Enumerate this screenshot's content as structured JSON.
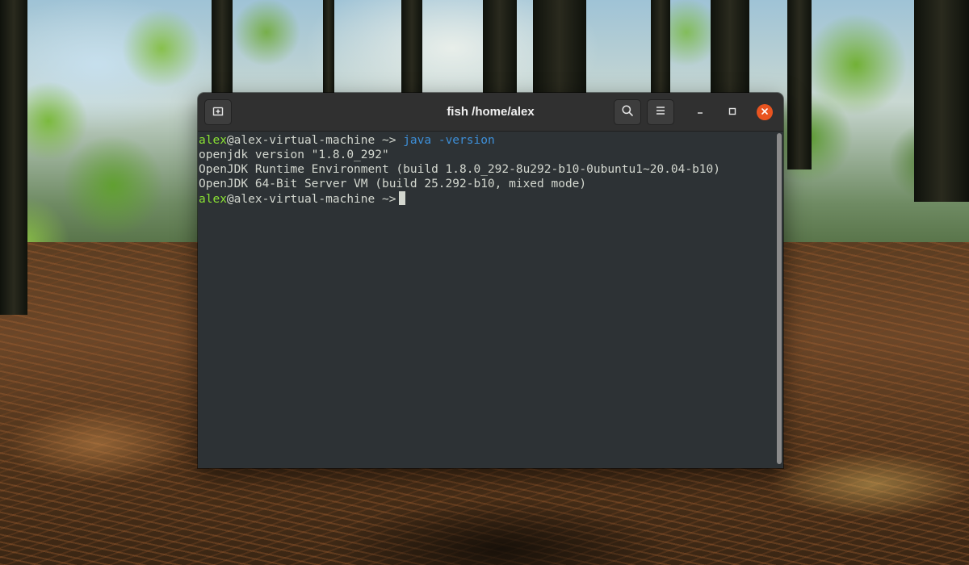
{
  "window": {
    "title": "fish /home/alex",
    "icons": {
      "new_tab": "new-tab-icon",
      "search": "search-icon",
      "menu": "hamburger-menu-icon",
      "minimize": "minimize-icon",
      "maximize": "maximize-icon",
      "close": "close-icon"
    },
    "colors": {
      "close_button": "#e95420",
      "terminal_bg": "#2d3235",
      "prompt_user": "#8ae234",
      "command": "#3d8fd8"
    }
  },
  "terminal": {
    "prompt": {
      "user": "alex",
      "host": "@alex-virtual-machine",
      "cwd": "~",
      "symbol": ">"
    },
    "command": {
      "name": "java",
      "args": "-version"
    },
    "output": [
      "openjdk version \"1.8.0_292\"",
      "OpenJDK Runtime Environment (build 1.8.0_292-8u292-b10-0ubuntu1~20.04-b10)",
      "OpenJDK 64-Bit Server VM (build 25.292-b10, mixed mode)"
    ]
  }
}
